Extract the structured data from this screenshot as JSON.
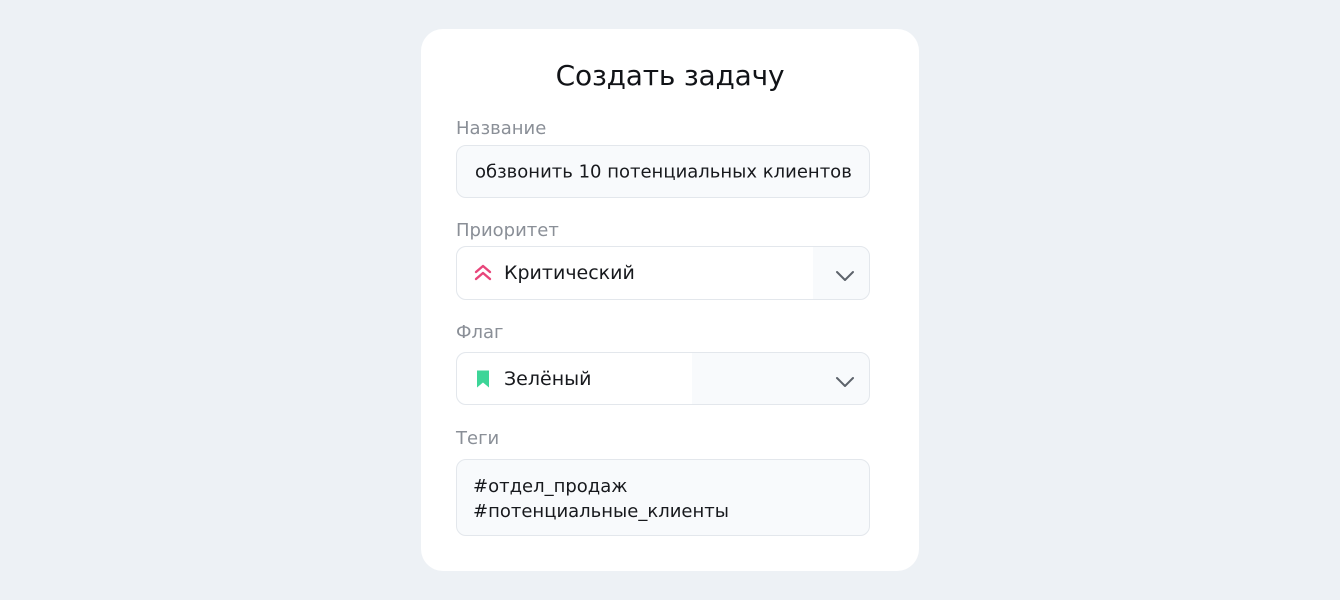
{
  "form": {
    "title": "Создать задачу",
    "name_label": "Название",
    "name_value": "обзвонить 10 потенциальных клиентов",
    "priority_label": "Приоритет",
    "priority_value": "Критический",
    "priority_icon": "double-chevron-up-icon",
    "flag_label": "Флаг",
    "flag_value": "Зелёный",
    "flag_icon": "bookmark-icon",
    "tags_label": "Теги",
    "tags": [
      "#отдел_продаж",
      "#потенциальные_клиенты"
    ]
  },
  "colors": {
    "background": "#edf1f5",
    "card": "#ffffff",
    "priority_accent": "#e8457a",
    "flag_accent": "#3dd598",
    "field_bg": "#f8fafc",
    "field_border": "#e3e7ec"
  }
}
